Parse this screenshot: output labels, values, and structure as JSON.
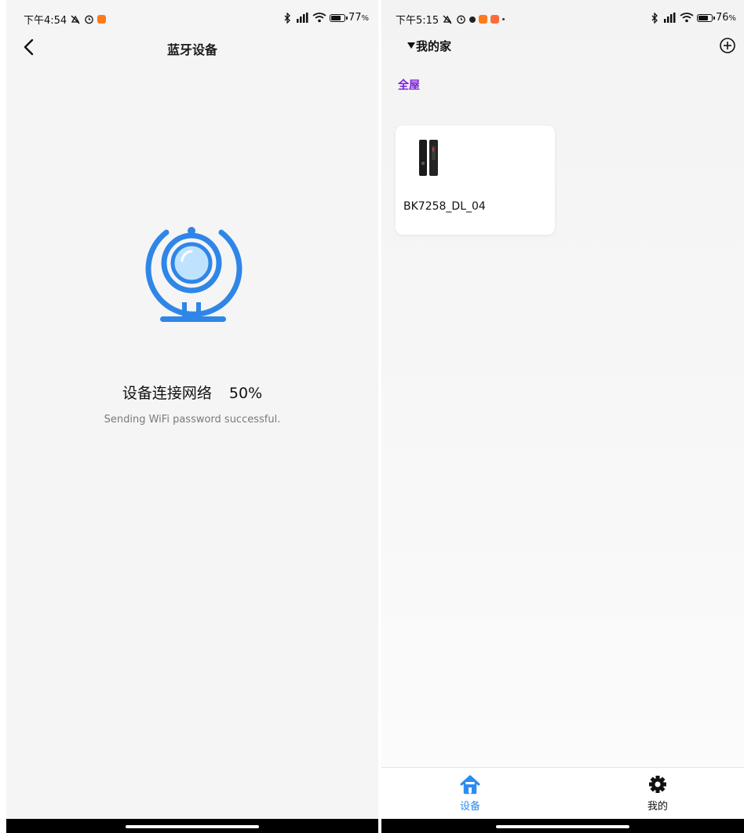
{
  "left_screen": {
    "status_bar": {
      "time": "下午4:54",
      "battery_percent": "77",
      "battery_unit": "%",
      "battery_level": 0.77
    },
    "header": {
      "title": "蓝牙设备"
    },
    "progress": {
      "label": "设备连接网络",
      "percent_text": "50%",
      "value": 0.5,
      "status_text": "Sending WiFi password successful."
    },
    "icons": {
      "back": "chevron-left-icon",
      "main": "webcam-icon"
    },
    "colors": {
      "accent": "#2f86e6",
      "lens": "#bfe3ff"
    }
  },
  "right_screen": {
    "status_bar": {
      "time": "下午5:15",
      "battery_percent": "76",
      "battery_unit": "%",
      "battery_level": 0.76
    },
    "home": {
      "name": "我的家"
    },
    "rooms": [
      {
        "label": "全屋",
        "active": true
      }
    ],
    "devices": [
      {
        "name": "BK7258_DL_04",
        "image": "smart-lock-device"
      }
    ],
    "tabs": [
      {
        "label": "设备",
        "icon": "home-icon",
        "active": true
      },
      {
        "label": "我的",
        "icon": "gear-icon",
        "active": false
      }
    ],
    "colors": {
      "room_active": "#7a1fd6",
      "tab_active": "#2d8cf0"
    }
  }
}
